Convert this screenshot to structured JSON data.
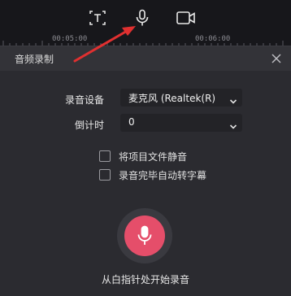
{
  "toolbar": {
    "icons": [
      "text-icon",
      "microphone-icon",
      "video-camera-icon"
    ]
  },
  "ruler": {
    "labels": [
      "00:05:00",
      "00:06:00"
    ]
  },
  "dialog": {
    "title": "音频录制",
    "device_label": "录音设备",
    "device_value": "麦克风 (Realtek(R)",
    "countdown_label": "倒计时",
    "countdown_value": "0",
    "mute_project_label": "将项目文件静音",
    "auto_subtitle_label": "录音完毕自动转字幕",
    "record_hint": "从白指针处开始录音"
  },
  "colors": {
    "background": "#202025",
    "dialog": "#2b2b30",
    "record_button": "#e54e6a",
    "annotation_arrow": "#e03030"
  }
}
